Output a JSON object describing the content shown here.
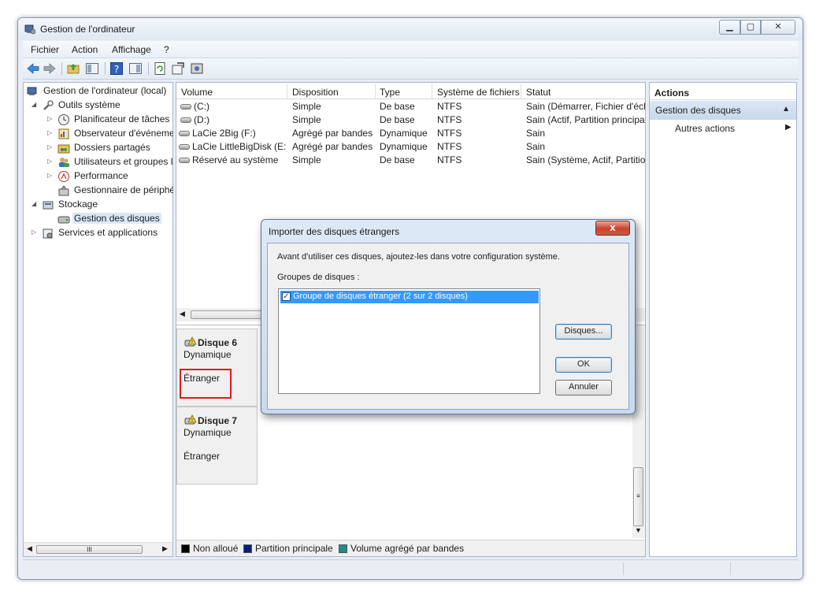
{
  "window": {
    "title": "Gestion de l'ordinateur"
  },
  "menu": [
    "Fichier",
    "Action",
    "Affichage",
    "?"
  ],
  "tree": [
    {
      "label": "Gestion de l'ordinateur (local)",
      "icon": "computer-mgmt-icon"
    },
    {
      "label": "Outils système",
      "icon": "tools-icon"
    },
    {
      "label": "Planificateur de tâches",
      "icon": "clock-icon"
    },
    {
      "label": "Observateur d'événeme",
      "icon": "event-viewer-icon"
    },
    {
      "label": "Dossiers partagés",
      "icon": "shared-folder-icon"
    },
    {
      "label": "Utilisateurs et groupes l",
      "icon": "users-icon"
    },
    {
      "label": "Performance",
      "icon": "performance-icon"
    },
    {
      "label": "Gestionnaire de périphé",
      "icon": "device-manager-icon"
    },
    {
      "label": "Stockage",
      "icon": "storage-icon"
    },
    {
      "label": "Gestion des disques",
      "icon": "disk-mgmt-icon"
    },
    {
      "label": "Services et applications",
      "icon": "services-icon"
    }
  ],
  "tree_scroll_grip": "III",
  "volumes": {
    "columns": [
      "Volume",
      "Disposition",
      "Type",
      "Système de fichiers",
      "Statut"
    ],
    "rows": [
      [
        "(C:)",
        "Simple",
        "De base",
        "NTFS",
        "Sain (Démarrer, Fichier d'éch"
      ],
      [
        "(D:)",
        "Simple",
        "De base",
        "NTFS",
        "Sain (Actif, Partition principa"
      ],
      [
        "LaCie 2Big (F:)",
        "Agrégé par bandes",
        "Dynamique",
        "NTFS",
        "Sain"
      ],
      [
        "LaCie LittleBigDisk (E:)",
        "Agrégé par bandes",
        "Dynamique",
        "NTFS",
        "Sain"
      ],
      [
        "Réservé au système",
        "Simple",
        "De base",
        "NTFS",
        "Sain (Système, Actif, Partition"
      ]
    ]
  },
  "disks": [
    {
      "name": "Disque 6",
      "type": "Dynamique",
      "state": "Étranger"
    },
    {
      "name": "Disque 7",
      "type": "Dynamique",
      "state": "Étranger"
    }
  ],
  "graph_scroll_grip": "≡",
  "legend": [
    {
      "label": "Non alloué",
      "color": "#000000"
    },
    {
      "label": "Partition principale",
      "color": "#0a1f7a"
    },
    {
      "label": "Volume agrégé par bandes",
      "color": "#1d8c8c"
    }
  ],
  "actions": {
    "header": "Actions",
    "section": "Gestion des disques",
    "item": "Autres actions"
  },
  "dialog": {
    "title": "Importer des disques étrangers",
    "instruction": "Avant d'utiliser ces disques, ajoutez-les dans votre configuration système.",
    "groups_label": "Groupes de disques :",
    "group_item": "Groupe de disques étranger (2 sur 2 disques)",
    "group_checked": true,
    "buttons": {
      "disques": "Disques...",
      "ok": "OK",
      "annuler": "Annuler"
    },
    "close_glyph": "x"
  },
  "colors": {
    "highlight": "#e01b1b",
    "selection": "#3399ff",
    "accent": "#c7d8ec"
  }
}
